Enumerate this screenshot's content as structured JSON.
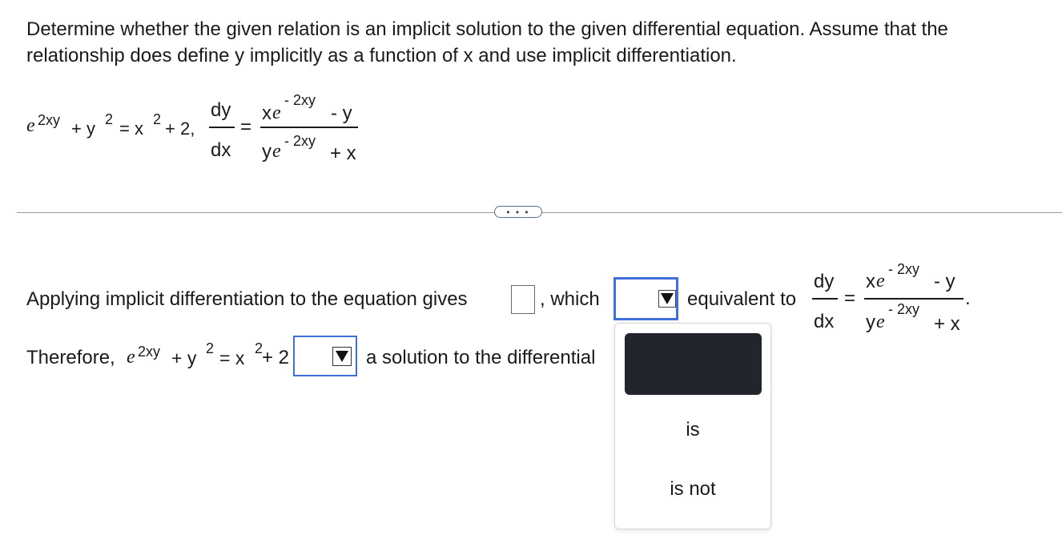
{
  "prompt": "Determine whether the given relation is an implicit solution to the given differential equation. Assume that the relationship does define y implicitly as a function of x and use implicit differentiation.",
  "given": {
    "e_base": "e",
    "e_exp": "2xy",
    "plus1": "+ y",
    "y_exp": "2",
    "eq": "= x",
    "x_exp": "2",
    "tail": "+ 2,",
    "dy": "dy",
    "dx": "dx",
    "equals": "=",
    "num_x": "x",
    "num_e": "e",
    "num_exp": "- 2xy",
    "num_tail": "- y",
    "den_y": "y",
    "den_e": "e",
    "den_exp": "- 2xy",
    "den_tail": "+ x"
  },
  "more_button": "• • •",
  "line1": {
    "text_before": "Applying implicit differentiation to the equation gives",
    "text_after_box": ", which",
    "text_after_select": "equivalent to",
    "dy": "dy",
    "dx": "dx",
    "equals": "=",
    "num_x": "x",
    "num_e": "e",
    "num_exp": "- 2xy",
    "num_tail": "- y",
    "den_y": "y",
    "den_e": "e",
    "den_exp": "- 2xy",
    "den_tail": "+ x",
    "period": "."
  },
  "line2": {
    "therefore": "Therefore,",
    "e_base": "e",
    "e_exp": "2xy",
    "plus1": "+ y",
    "y_exp": "2",
    "eq": "= x",
    "x_exp": "2",
    "tail": "+ 2",
    "text_after_select": "a solution to the differential"
  },
  "dropdown": {
    "options": [
      "is",
      "is not"
    ]
  },
  "colors": {
    "focus_border": "#3f6fd8",
    "dropdown_highlight": "#22262c"
  }
}
